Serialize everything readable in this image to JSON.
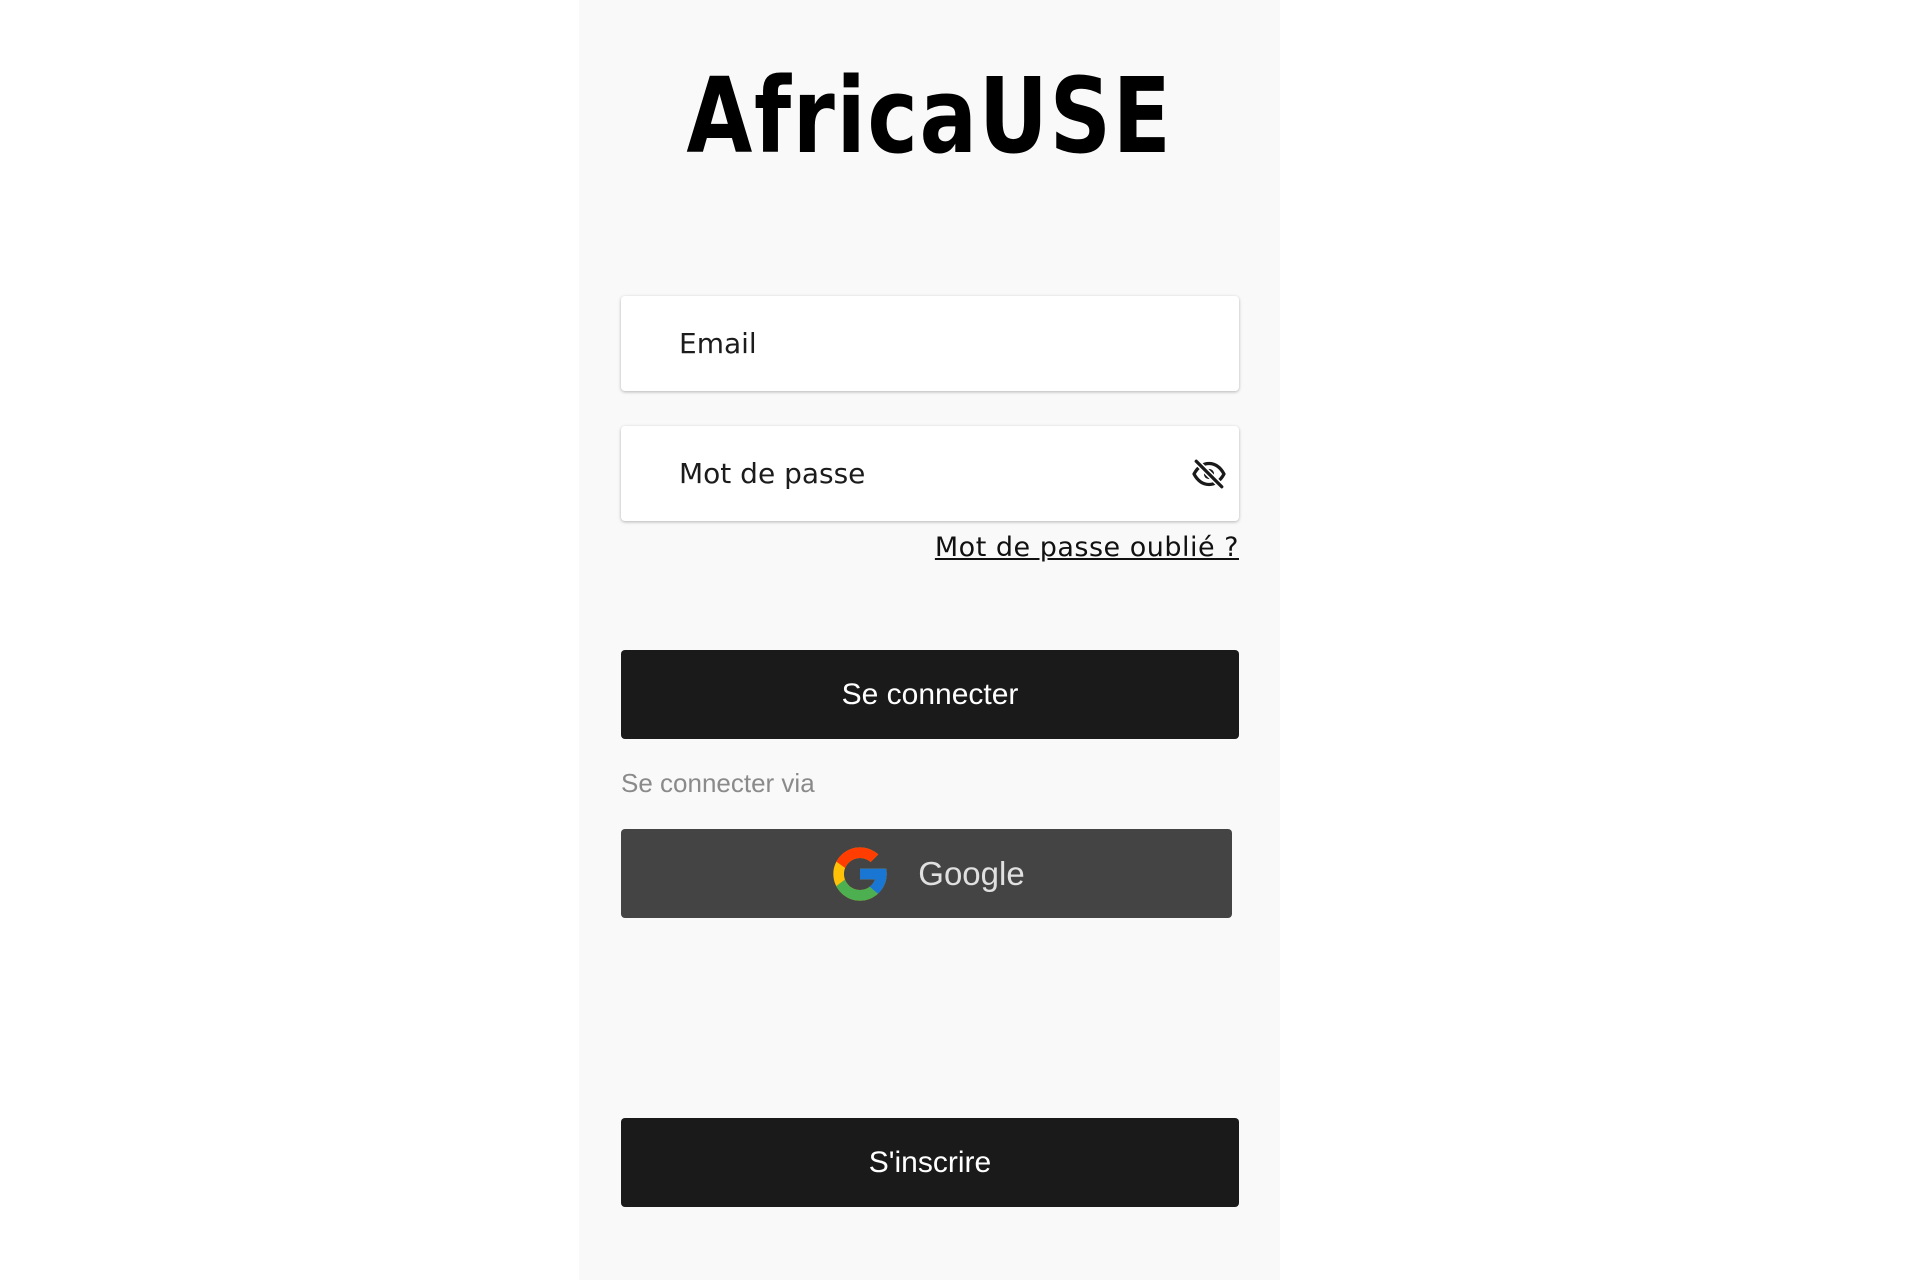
{
  "app": {
    "logo_text": "AfricaUSE"
  },
  "form": {
    "email_placeholder": "Email",
    "password_placeholder": "Mot de passe",
    "password_toggle_icon": "eye-off-icon",
    "forgot_password_label": "Mot de passe oublié ?",
    "login_button_label": "Se connecter",
    "social_login_label": "Se connecter via",
    "google_button_label": "Google",
    "signup_button_label": "S'inscrire"
  },
  "colors": {
    "screen_background": "#f9f9f9",
    "primary_button": "#1a1a1a",
    "google_button": "#444444",
    "muted_text": "#8a8a8a"
  }
}
